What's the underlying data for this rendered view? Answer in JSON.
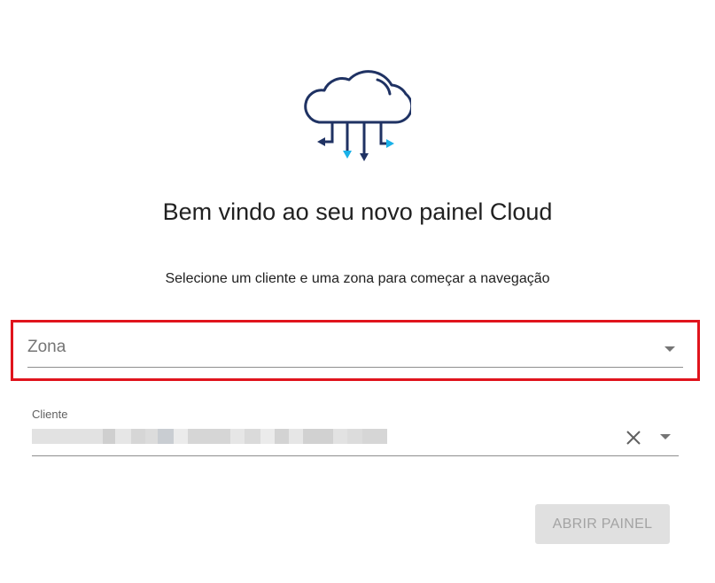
{
  "welcome": {
    "title": "Bem vindo ao seu novo painel Cloud",
    "subtitle": "Selecione um cliente e uma zona para começar a navegação"
  },
  "zona_select": {
    "placeholder": "Zona"
  },
  "cliente_select": {
    "label": "Cliente",
    "value_obscured": true
  },
  "actions": {
    "open_panel_label": "ABRIR PAINEL",
    "open_panel_disabled": true
  },
  "icons": {
    "logo": "cloud-data-transfer-icon",
    "clear": "close-icon",
    "dropdown": "caret-down-icon"
  },
  "colors": {
    "logo_dark_blue": "#1f3263",
    "logo_light_blue": "#1ab1e8",
    "highlight_red": "#e0141d",
    "button_disabled_bg": "#e0e0e0",
    "button_disabled_text": "#a3a3a3"
  }
}
